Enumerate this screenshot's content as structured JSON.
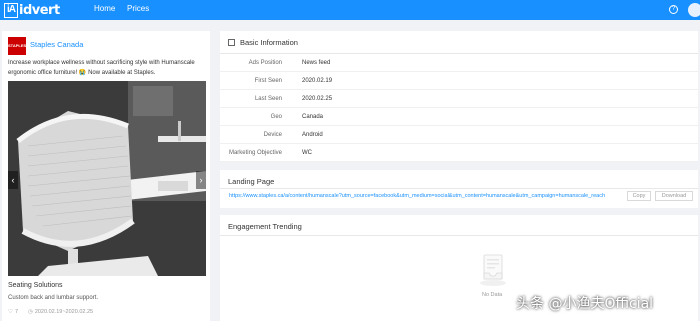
{
  "header": {
    "logo_mark": "iA",
    "logo_text": "idvert",
    "nav": [
      "Home",
      "Prices"
    ],
    "help_icon": "?"
  },
  "ad": {
    "advertiser_avatar_text": "STAPLES",
    "advertiser": "Staples Canada",
    "text": "Increase workplace wellness without sacrificing style with Humanscale ergonomic office furniture! 😭 Now available at Staples.",
    "headline": "Seating Solutions",
    "description": "Custom back and lumbar support.",
    "meta_count": "7",
    "meta_dates": "2020.02.19~2020.02.25",
    "prev": "‹",
    "next": "›"
  },
  "basic_info": {
    "title": "Basic Information",
    "rows": [
      {
        "label": "Ads Position",
        "value": "News feed"
      },
      {
        "label": "First Seen",
        "value": "2020.02.19"
      },
      {
        "label": "Last Seen",
        "value": "2020.02.25"
      },
      {
        "label": "Geo",
        "value": "Canada"
      },
      {
        "label": "Device",
        "value": "Android"
      },
      {
        "label": "Marketing Objective",
        "value": "WC"
      }
    ]
  },
  "landing": {
    "title": "Landing Page",
    "url": "https://www.staples.ca/a/content/humanscale?utm_source=facebook&utm_medium=social&utm_content=humanscale&utm_campaign=humanscale_reach",
    "copy": "Copy",
    "download": "Download"
  },
  "engagement": {
    "title": "Engagement Trending",
    "empty": "No Data"
  },
  "watermark": "头条 @小渔夫Official"
}
